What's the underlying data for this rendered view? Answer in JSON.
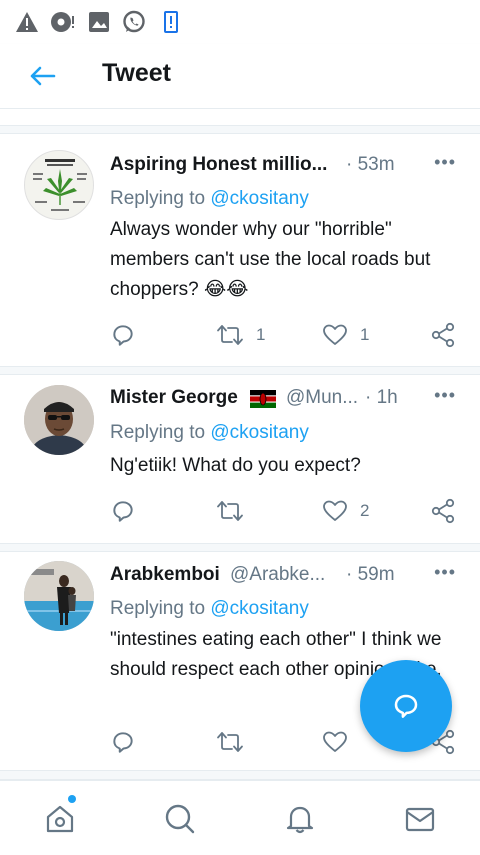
{
  "colors": {
    "accent": "#1da1f2",
    "secondary_text": "#657786",
    "primary_text": "#14171a",
    "divider": "#e6ecf0"
  },
  "status_bar": {
    "icons": [
      "warning-icon",
      "record-icon",
      "image-icon",
      "whatsapp-icon",
      "phone-alert-icon"
    ]
  },
  "header": {
    "title": "Tweet",
    "back_icon": "arrow-left-icon"
  },
  "tweets": [
    {
      "name": "Aspiring Honest millio...",
      "handle": "",
      "time": "· 53m",
      "reply_prefix": "Replying to ",
      "reply_to": "@ckositany",
      "text": "Always wonder why our \"horrible\" members can't use the local roads but choppers? 😂😂",
      "retweets": "1",
      "likes": "1",
      "avatar": "marijuana-poster-avatar"
    },
    {
      "name": "Mister George",
      "flag": "kenya-flag",
      "handle": "@Mun...",
      "time": "· 1h",
      "reply_prefix": "Replying to ",
      "reply_to": "@ckositany",
      "text": "Ng'etiik! What do you expect?",
      "retweets": "",
      "likes": "2",
      "avatar": "man-with-cap-avatar"
    },
    {
      "name": "Arabkemboi",
      "handle": "@Arabke...",
      "time": "· 59m",
      "reply_prefix": "Replying to ",
      "reply_to": "@ckositany",
      "text": "\"intestines eating each other\" I think we should respect each other opinion/take.",
      "retweets": "",
      "likes": "",
      "avatar": "pool-photo-avatar"
    }
  ],
  "fab": {
    "icon": "compose-reply-icon"
  },
  "bottom_nav": [
    "home-icon",
    "search-icon",
    "notifications-icon",
    "messages-icon"
  ]
}
